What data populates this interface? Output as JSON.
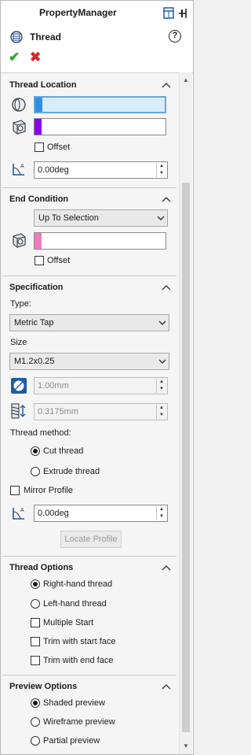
{
  "header": {
    "app_title": "PropertyManager",
    "feature_title": "Thread",
    "help_glyph": "?"
  },
  "thread_location": {
    "title": "Thread Location",
    "offset_label": "Offset",
    "angle_value": "0.00deg",
    "edge_color": "#2f8fe0",
    "face_color": "#8b00e6"
  },
  "end_condition": {
    "title": "End Condition",
    "type_value": "Up To Selection",
    "offset_label": "Offset",
    "selection_color": "#f07ac0"
  },
  "specification": {
    "title": "Specification",
    "type_label": "Type:",
    "type_value": "Metric Tap",
    "size_label": "Size",
    "size_value": "M1.2x0.25",
    "diameter_value": "1.00mm",
    "pitch_value": "0.3175mm",
    "thread_method_label": "Thread method:",
    "cut_thread_label": "Cut thread",
    "extrude_thread_label": "Extrude thread",
    "mirror_profile_label": "Mirror Profile",
    "angle_value": "0.00deg",
    "locate_profile_label": "Locate Profile"
  },
  "thread_options": {
    "title": "Thread Options",
    "right_hand_label": "Right-hand thread",
    "left_hand_label": "Left-hand thread",
    "multiple_start_label": "Multiple Start",
    "trim_start_label": "Trim with start face",
    "trim_end_label": "Trim with end face"
  },
  "preview_options": {
    "title": "Preview Options",
    "shaded_label": "Shaded preview",
    "wireframe_label": "Wireframe preview",
    "partial_label": "Partial preview"
  }
}
